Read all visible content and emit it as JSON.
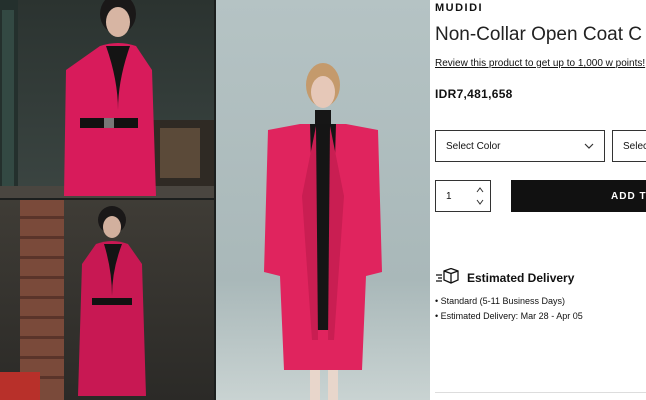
{
  "photos": {
    "top_left": "drama-scene-woman-in-pink-coat",
    "bottom_left": "drama-scene-woman-in-pink-coat-full-length",
    "center": "model-wearing-pink-non-collar-coat"
  },
  "product": {
    "brand": "MUDIDI",
    "title": "Non-Collar Open Coat C",
    "review_link": "Review this product to get up to 1,000 w points!",
    "price": "IDR7,481,658",
    "color_select": "Select Color",
    "size_select": "Selec",
    "quantity": "1",
    "add_button": "ADD TO",
    "delivery": {
      "title": "Estimated Delivery",
      "items": [
        "Standard (5-11 Business Days)",
        "Estimated Delivery: Mar 28 - Apr 05"
      ]
    }
  },
  "colors": {
    "coat": "#e0245e",
    "button_bg": "#111111"
  }
}
